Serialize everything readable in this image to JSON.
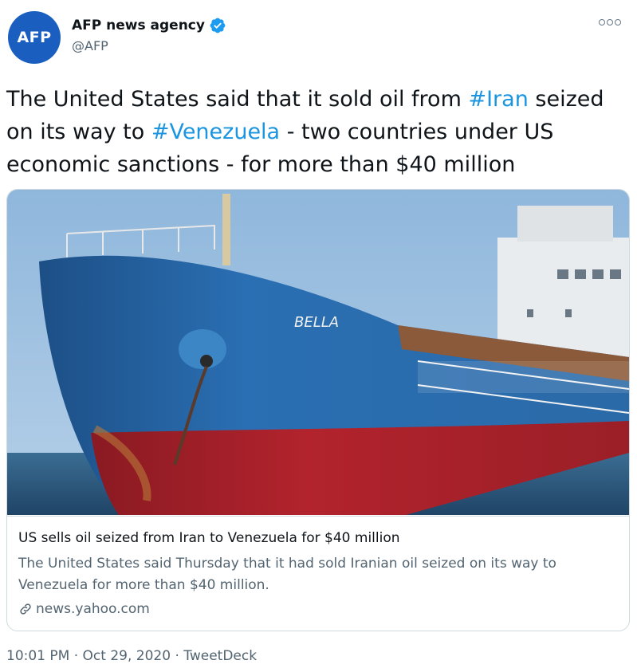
{
  "author": {
    "avatar_text": "AFP",
    "display_name": "AFP news agency",
    "handle": "@AFP",
    "verified": true
  },
  "tweet": {
    "segments": [
      {
        "text": "The United States said that it sold oil from ",
        "type": "text"
      },
      {
        "text": "#Iran",
        "type": "hashtag"
      },
      {
        "text": " seized on its way to ",
        "type": "text"
      },
      {
        "text": "#Venezuela",
        "type": "hashtag"
      },
      {
        "text": " - two countries under US economic sanctions - for more than $40 million",
        "type": "text"
      }
    ]
  },
  "card": {
    "image_ship_name": "BELLA",
    "title": "US sells oil seized from Iran to Venezuela for $40 million",
    "description": "The United States said Thursday that it had sold Iranian oil seized on its way to Venezuela for more than $40 million.",
    "domain": "news.yahoo.com"
  },
  "meta": {
    "time": "10:01 PM",
    "separator": "·",
    "date": "Oct 29, 2020",
    "source": "TweetDeck"
  },
  "colors": {
    "brand_avatar": "#1a5fc0",
    "hashtag": "#1b95e0",
    "verified": "#1d9bf0",
    "secondary_text": "#536471"
  },
  "icons": {
    "more": "more-options-icon",
    "verified": "verified-badge-icon",
    "link": "link-icon"
  }
}
